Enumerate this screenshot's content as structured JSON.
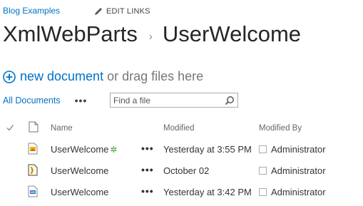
{
  "top_nav": {
    "site_link": "Blog Examples",
    "edit_links": "EDIT LINKS"
  },
  "breadcrumb": {
    "parent": "XmlWebParts",
    "separator": "›",
    "current": "UserWelcome"
  },
  "actions": {
    "new_document": "new document",
    "drag_text": "or drag files here"
  },
  "view": {
    "current_view": "All Documents",
    "more": "•••"
  },
  "search": {
    "placeholder": "Find a file"
  },
  "table": {
    "columns": {
      "name": "Name",
      "modified": "Modified",
      "modified_by": "Modified By"
    },
    "rows": [
      {
        "name": "UserWelcome",
        "new_badge": "✲",
        "icon": "xml-web-part-icon",
        "menu": "•••",
        "modified": "Yesterday at 3:55 PM",
        "modified_by": "Administrator"
      },
      {
        "name": "UserWelcome",
        "icon": "xsl-file-icon",
        "menu": "•••",
        "modified": "October 02",
        "modified_by": "Administrator"
      },
      {
        "name": "UserWelcome",
        "icon": "xml-file-icon",
        "menu": "•••",
        "modified": "Yesterday at 3:42 PM",
        "modified_by": "Administrator"
      }
    ]
  },
  "colors": {
    "link": "#0072c6",
    "text": "#444444",
    "new_badge": "#3f9a2d"
  }
}
